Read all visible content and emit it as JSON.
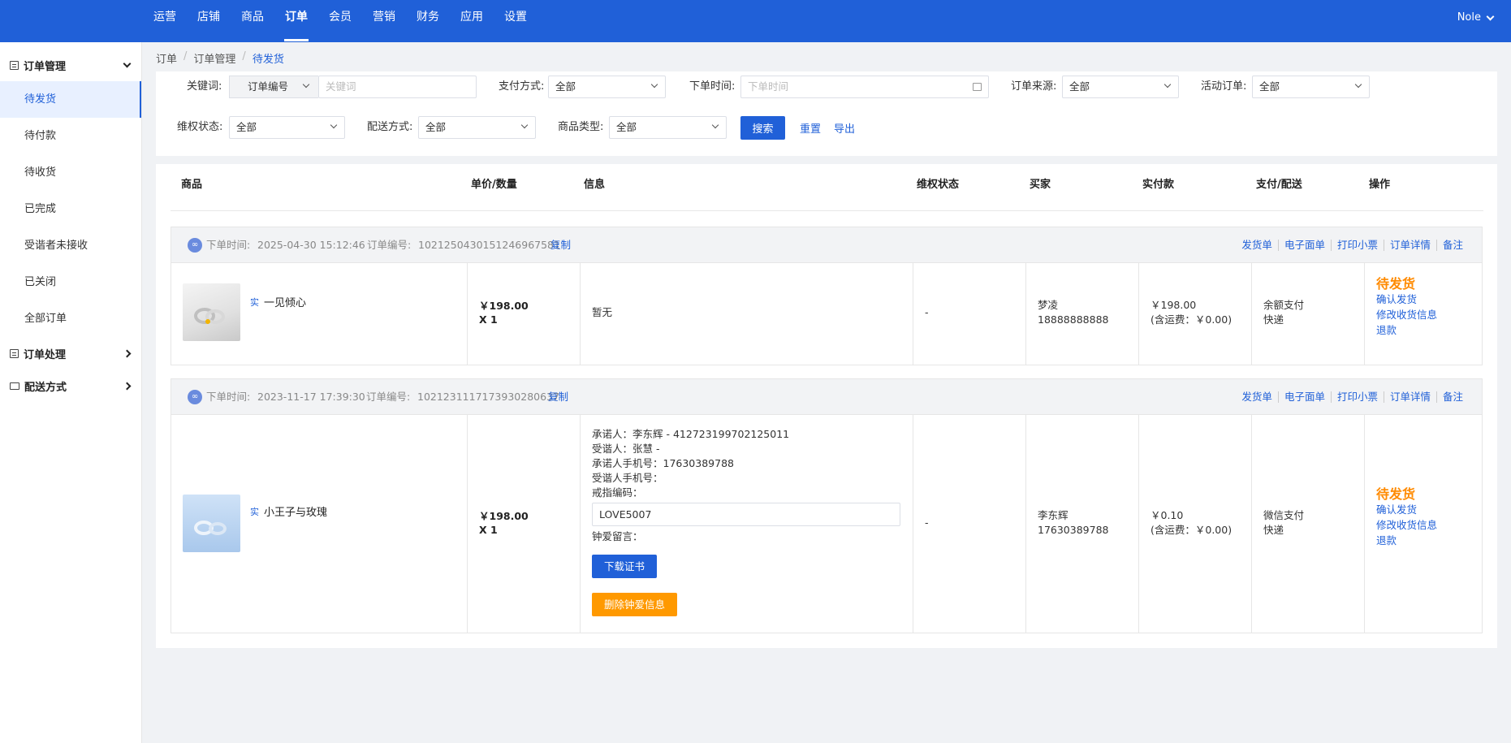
{
  "topnav": {
    "items": [
      "运营",
      "店铺",
      "商品",
      "订单",
      "会员",
      "营销",
      "财务",
      "应用",
      "设置"
    ],
    "active_index": 3,
    "user": "Nole"
  },
  "sidebar": {
    "group1": "订单管理",
    "items": [
      "待发货",
      "待付款",
      "待收货",
      "已完成",
      "受谐者未接收",
      "已关闭",
      "全部订单"
    ],
    "active_index": 0,
    "group2": "订单处理",
    "group3": "配送方式"
  },
  "breadcrumb": [
    "订单",
    "订单管理",
    "待发货"
  ],
  "filters": {
    "keyword_label": "关键词:",
    "keyword_type": "订单编号",
    "keyword_placeholder": "关键词",
    "pay_label": "支付方式:",
    "pay_value": "全部",
    "time_label": "下单时间:",
    "time_placeholder": "下单时间",
    "source_label": "订单来源:",
    "source_value": "全部",
    "activity_label": "活动订单:",
    "activity_value": "全部",
    "rights_label": "维权状态:",
    "rights_value": "全部",
    "delivery_label": "配送方式:",
    "delivery_value": "全部",
    "goods_label": "商品类型:",
    "goods_value": "全部",
    "search": "搜索",
    "reset": "重置",
    "export": "导出"
  },
  "table": {
    "headers": [
      "商品",
      "单价/数量",
      "信息",
      "维权状态",
      "买家",
      "实付款",
      "支付/配送",
      "操作"
    ]
  },
  "order_actions": [
    "发货单",
    "电子面单",
    "打印小票",
    "订单详情",
    "备注"
  ],
  "orders": [
    {
      "time_label": "下单时间:",
      "time": "2025-04-30 15:12:46",
      "no_label": "订单编号:",
      "no": "1021250430151246967581",
      "copy": "复制",
      "tag": "实",
      "product": "一见倾心",
      "price": "￥198.00",
      "qty": "X 1",
      "info": "暂无",
      "rights": "-",
      "buyer_name": "梦凌",
      "buyer_phone": "18888888888",
      "paid": "￥198.00",
      "paid_note": "(含运费：￥0.00)",
      "pay_method": "余额支付",
      "delivery": "快递",
      "status": "待发货",
      "actions": [
        "确认发货",
        "修改收货信息",
        "退款"
      ]
    },
    {
      "time_label": "下单时间:",
      "time": "2023-11-17 17:39:30",
      "no_label": "订单编号:",
      "no": "1021231117173930280637",
      "copy": "复制",
      "tag": "实",
      "product": "小王子与玫瑰",
      "price": "￥198.00",
      "qty": "X 1",
      "info_lines": [
        "承诺人：李东辉 - 412723199702125011",
        "受谐人：张慧 -",
        "承诺人手机号：17630389788",
        "受谐人手机号：",
        "戒指编码："
      ],
      "ring_code": "LOVE5007",
      "message_label": "钟爱留言：",
      "download_btn": "下载证书",
      "delete_btn": "删除钟爱信息",
      "rights": "-",
      "buyer_name": "李东辉",
      "buyer_phone": "17630389788",
      "paid": "￥0.10",
      "paid_note": "(含运费：￥0.00)",
      "pay_method": "微信支付",
      "delivery": "快递",
      "status": "待发货",
      "actions": [
        "确认发货",
        "修改收货信息",
        "退款"
      ]
    }
  ],
  "colors": {
    "brand": "#2060d8",
    "status_orange": "#ff8a00",
    "delete_button": "#ff9900"
  }
}
